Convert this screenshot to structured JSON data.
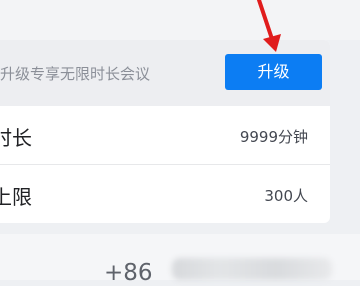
{
  "upgrade_panel": {
    "text": "升级专享无限时长会议",
    "button_label": "升级"
  },
  "features": [
    {
      "label": "时长",
      "value": "9999分钟"
    },
    {
      "label": "上限",
      "value": "300人"
    }
  ],
  "contact": {
    "phone_prefix": "+86"
  },
  "colors": {
    "button_blue": "#0c7df3",
    "annotation_red": "#e01c1c"
  },
  "icons": {
    "annotation": "red-arrow-icon"
  }
}
